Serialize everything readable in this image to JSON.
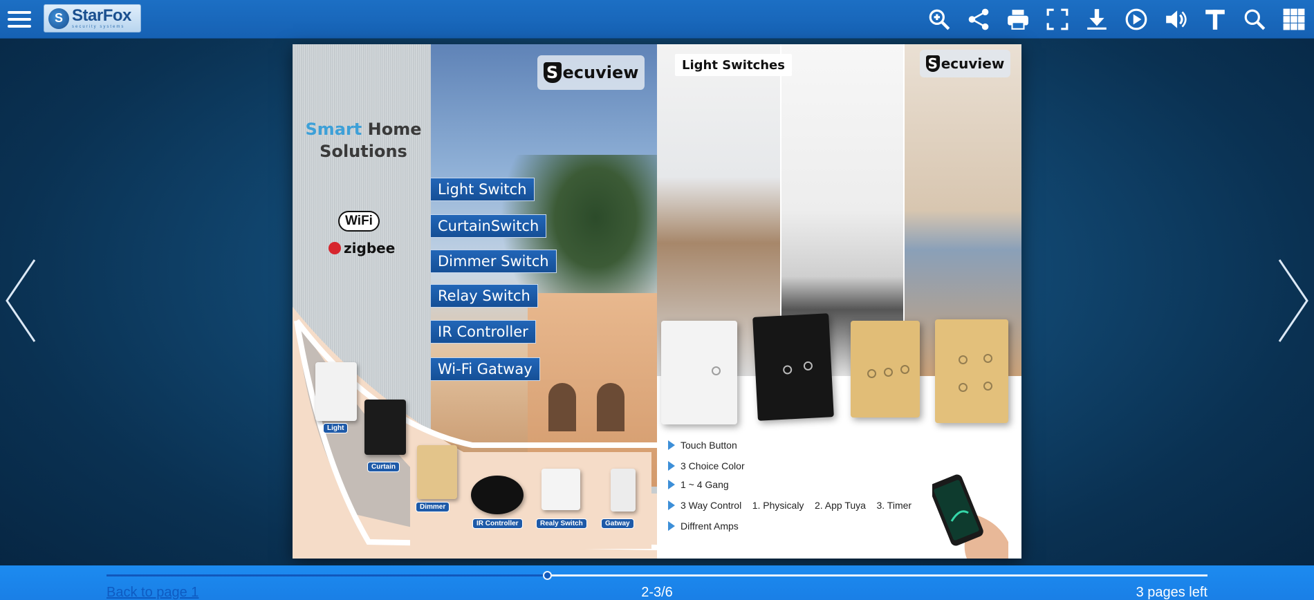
{
  "toolbar": {
    "brand_name": "StarFox",
    "brand_tagline": "security systems",
    "tools": [
      {
        "name": "zoom-in",
        "icon": "zoom-in-icon"
      },
      {
        "name": "share",
        "icon": "share-icon"
      },
      {
        "name": "print",
        "icon": "print-icon"
      },
      {
        "name": "fullscreen",
        "icon": "fullscreen-icon"
      },
      {
        "name": "download",
        "icon": "download-icon"
      },
      {
        "name": "autoplay",
        "icon": "play-icon"
      },
      {
        "name": "sound",
        "icon": "volume-icon"
      },
      {
        "name": "text",
        "icon": "text-icon"
      },
      {
        "name": "search",
        "icon": "search-icon"
      },
      {
        "name": "thumbnails",
        "icon": "grid-icon"
      }
    ]
  },
  "left_page": {
    "brand": "ecuview",
    "brand_initial": "S",
    "headline_accent": "Smart",
    "headline_rest": " Home",
    "headline_line2": "Solutions",
    "wifi": "WiFi",
    "zigbee": "zigbee",
    "features": [
      "Light Switch",
      "CurtainSwitch",
      "Dimmer Switch",
      "Relay Switch",
      "IR Controller",
      "Wi-Fi Gatway"
    ],
    "product_labels": [
      "Light",
      "Curtain",
      "Dimmer",
      "IR Controller",
      "Realy Switch",
      "Gatway"
    ]
  },
  "right_page": {
    "title": "Light Switches",
    "brand": "ecuview",
    "brand_initial": "S",
    "specs": [
      "Touch Button",
      "3 Choice Color",
      "1 ~ 4 Gang",
      "3 Way Control    1. Physicaly    2. App Tuya    3. Timer",
      "Diffrent Amps"
    ]
  },
  "footer": {
    "back_label": "Back to page 1",
    "page_indicator": "2-3/6",
    "pages_left": "3 pages left",
    "progress": 0.4
  },
  "colors": {
    "toolbar": "#1c6fc4",
    "footer": "#1a7fe6",
    "accent": "#3da0d8",
    "feature_bg": "#1e5aa8"
  }
}
